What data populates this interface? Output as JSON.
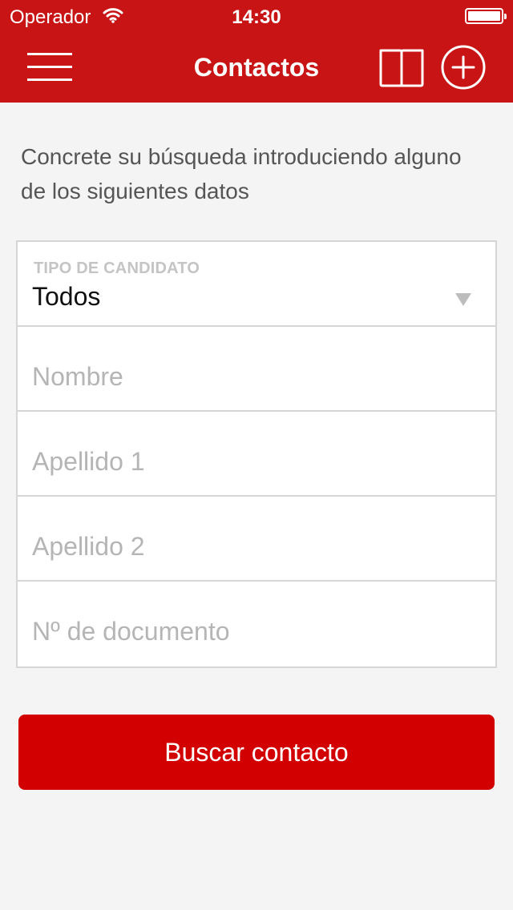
{
  "status_bar": {
    "carrier": "Operador",
    "time": "14:30"
  },
  "navbar": {
    "title": "Contactos"
  },
  "intro_text": "Concrete su búsqueda introduciendo alguno de los siguientes datos",
  "form": {
    "candidate_type": {
      "label": "TIPO DE CANDIDATO",
      "value": "Todos"
    },
    "nombre": {
      "placeholder": "Nombre",
      "value": ""
    },
    "apellido1": {
      "placeholder": "Apellido 1",
      "value": ""
    },
    "apellido2": {
      "placeholder": "Apellido 2",
      "value": ""
    },
    "documento": {
      "placeholder": "Nº de documento",
      "value": ""
    }
  },
  "search_button": {
    "label": "Buscar contacto"
  },
  "colors": {
    "header_red": "#c81414",
    "button_red": "#d20000",
    "background": "#f4f4f4"
  },
  "icons": {
    "menu": "hamburger-menu-icon",
    "book": "book-icon",
    "add": "plus-circle-icon",
    "dropdown": "triangle-down-icon",
    "wifi": "wifi-icon",
    "battery": "battery-icon"
  }
}
